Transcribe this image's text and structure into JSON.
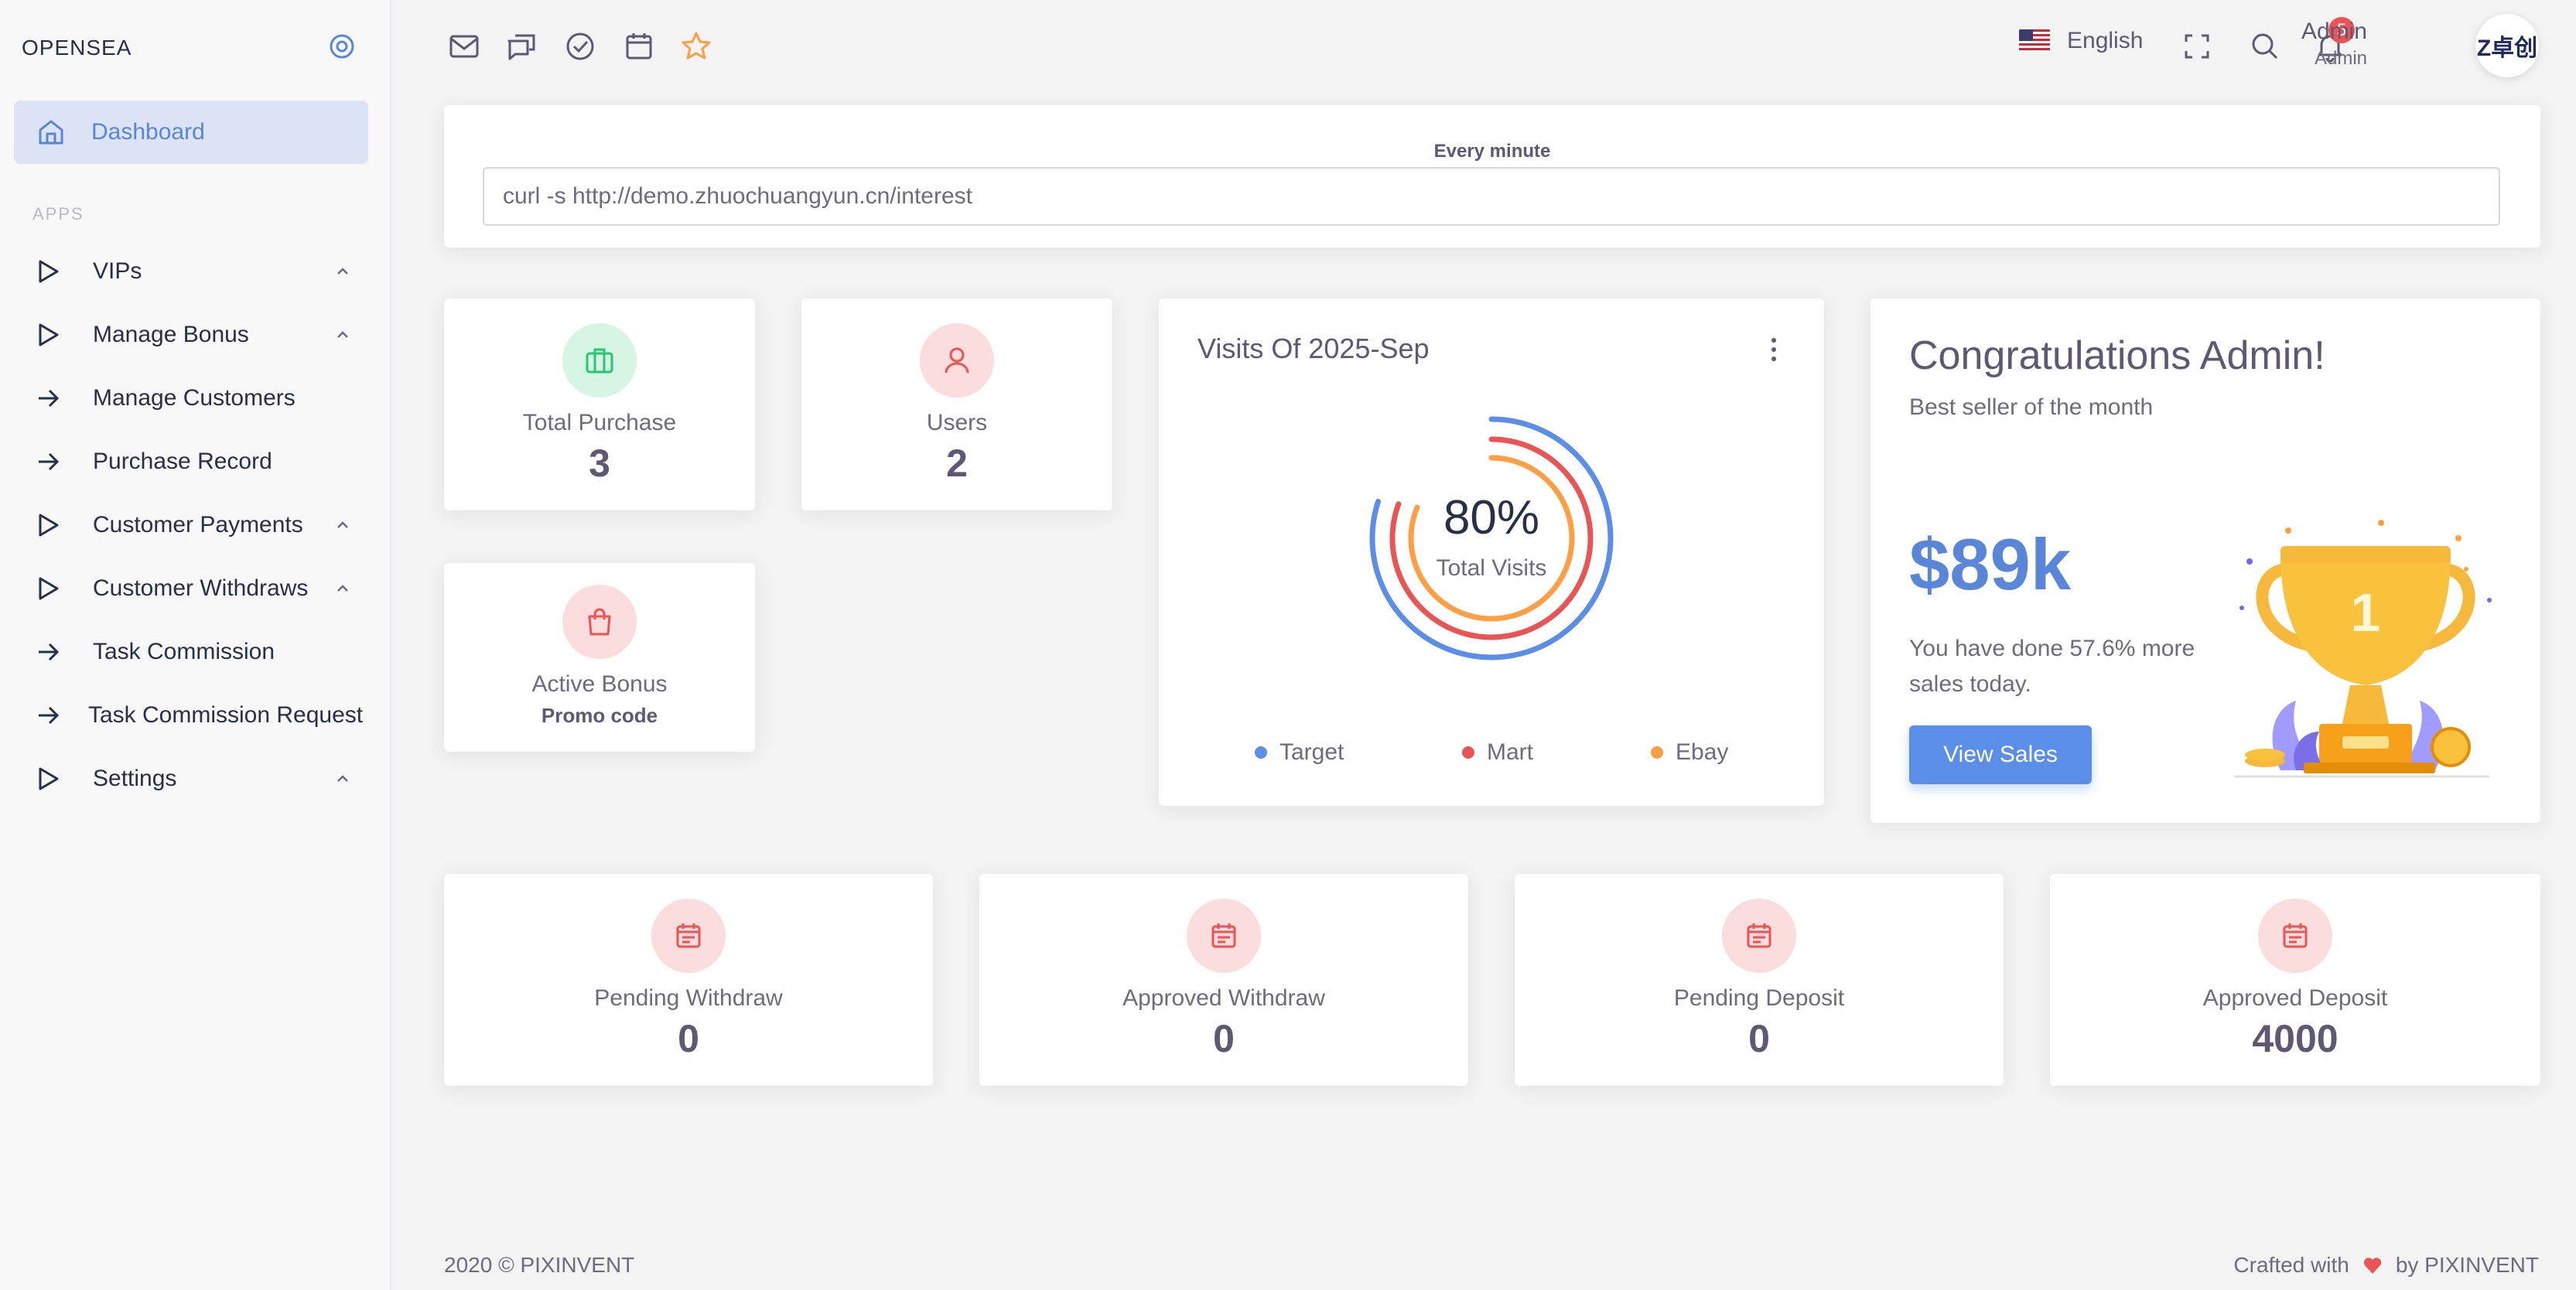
{
  "sidebar": {
    "brand": "OPENSEA",
    "active_item": {
      "label": "Dashboard",
      "icon": "home-icon"
    },
    "section_header": "APPS",
    "items": [
      {
        "label": "VIPs",
        "icon": "play-icon",
        "expandable": true
      },
      {
        "label": "Manage Bonus",
        "icon": "play-icon",
        "expandable": true
      },
      {
        "label": "Manage Customers",
        "icon": "arrow-right-icon",
        "expandable": false
      },
      {
        "label": "Purchase Record",
        "icon": "arrow-right-icon",
        "expandable": false
      },
      {
        "label": "Customer Payments",
        "icon": "play-icon",
        "expandable": true
      },
      {
        "label": "Customer Withdraws",
        "icon": "play-icon",
        "expandable": true
      },
      {
        "label": "Task Commission",
        "icon": "arrow-right-icon",
        "expandable": false
      },
      {
        "label": "Task Commission Request",
        "icon": "arrow-right-icon",
        "expandable": false
      },
      {
        "label": "Settings",
        "icon": "play-icon",
        "expandable": true
      }
    ]
  },
  "topbar": {
    "bookmarks": [
      "mail-icon",
      "chat-icon",
      "check-circle-icon",
      "calendar-icon",
      "star-icon"
    ],
    "language": "English",
    "notification_count": "5",
    "user_name": "Admin",
    "user_role": "Admin",
    "avatar_text": "Z卓创"
  },
  "cron": {
    "label": "Every minute",
    "value": "curl -s http://demo.zhuochuangyun.cn/interest"
  },
  "stats": {
    "total_purchase": {
      "label": "Total Purchase",
      "value": "3",
      "color": "#28c76f"
    },
    "users": {
      "label": "Users",
      "value": "2",
      "color": "#ea5455"
    },
    "active_bonus": {
      "label": "Active Bonus",
      "sub": "Promo code",
      "color": "#ea5455"
    },
    "pending_withdraw": {
      "label": "Pending Withdraw",
      "value": "0"
    },
    "approved_withdraw": {
      "label": "Approved Withdraw",
      "value": "0"
    },
    "pending_deposit": {
      "label": "Pending Deposit",
      "value": "0"
    },
    "approved_deposit": {
      "label": "Approved Deposit",
      "value": "4000"
    }
  },
  "chart_data": {
    "type": "radialBar",
    "title": "Visits Of 2025-Sep",
    "center_value": "80%",
    "center_label": "Total Visits",
    "series": [
      {
        "name": "Target",
        "value": 80,
        "color": "#5a8ee8"
      },
      {
        "name": "Mart",
        "value": 80,
        "color": "#ea5455"
      },
      {
        "name": "Ebay",
        "value": 80,
        "color": "#ff9f43"
      }
    ]
  },
  "congrats": {
    "title": "Congratulations Admin!",
    "subtitle": "Best seller of the month",
    "amount": "$89k",
    "description": "You have done 57.6% more sales today.",
    "button": "View Sales"
  },
  "footer": {
    "left": "2020 © PIXINVENT",
    "crafted": "Crafted with",
    "by": "by PIXINVENT"
  }
}
